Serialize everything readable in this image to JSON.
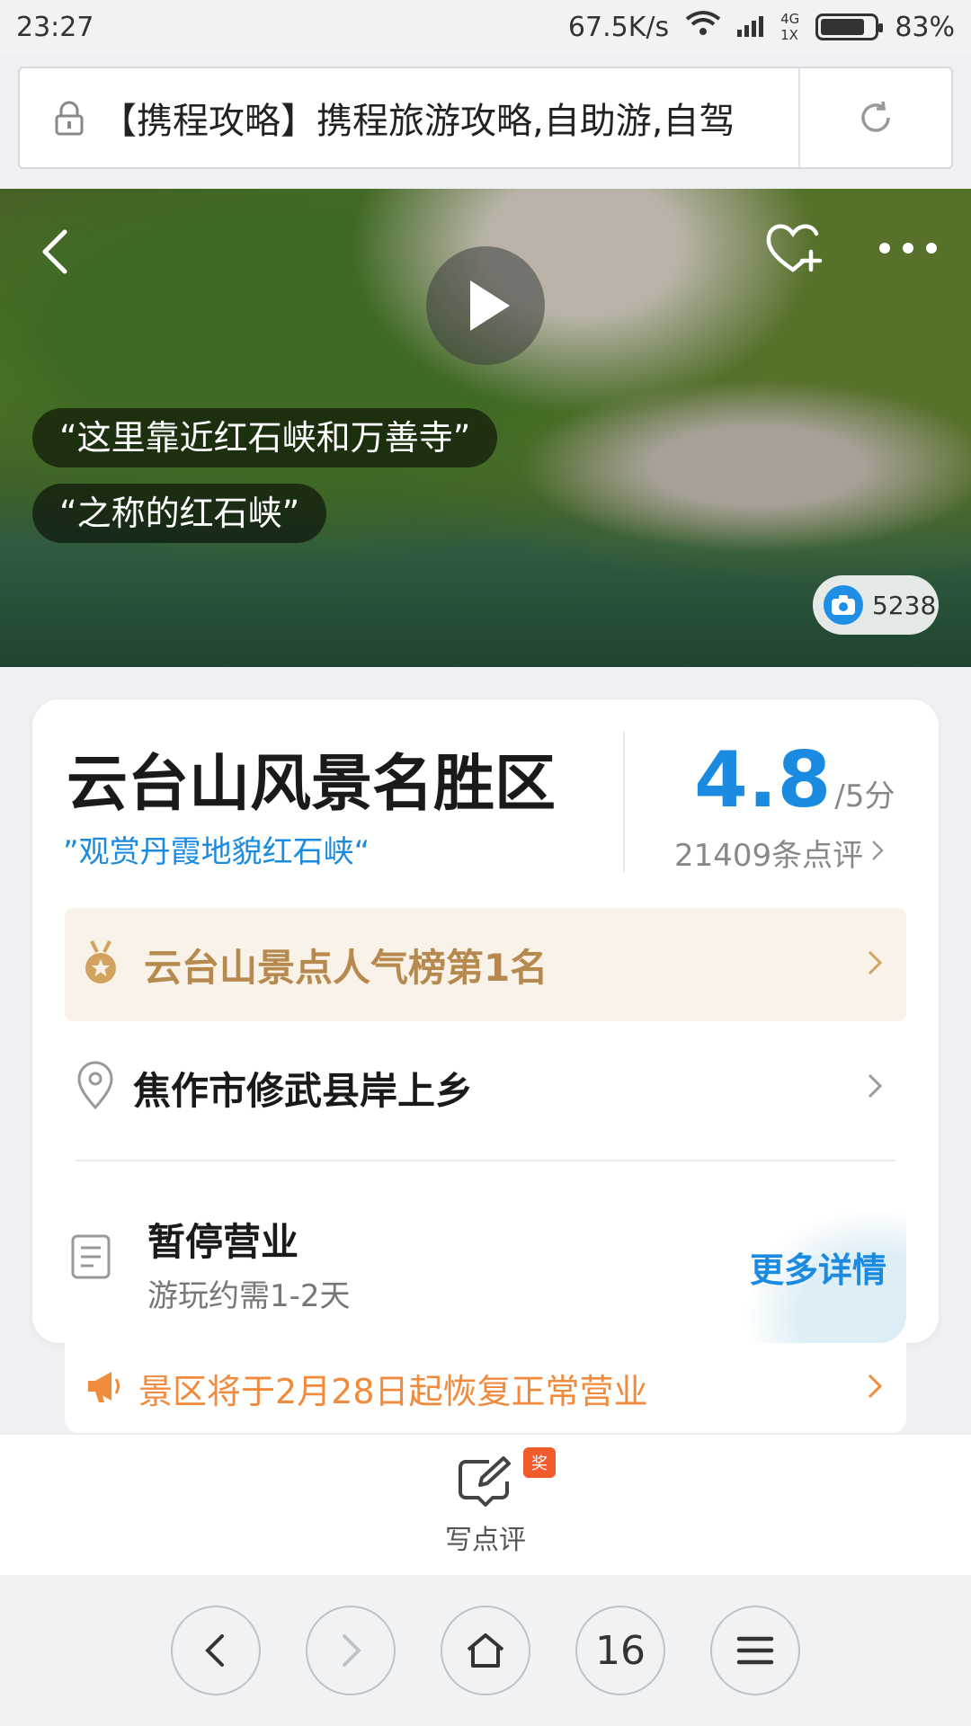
{
  "status_bar": {
    "time": "23:27",
    "network_speed": "67.5K/s",
    "network_type": "4G",
    "sim": "1X",
    "battery_percent": "83%",
    "battery_level": 0.83
  },
  "url_bar": {
    "title": "【携程攻略】携程旅游攻略,自助游,自驾"
  },
  "hero": {
    "quote_1": "“这里靠近红石峡和万善寺”",
    "quote_2": "“之称的红石峡”",
    "photo_count": "5238"
  },
  "attraction": {
    "name": "云台山风景名胜区",
    "tagline": "”观赏丹霞地貌红石峡“",
    "rating": "4.8",
    "rating_max": "/5分",
    "review_count": "21409条点评",
    "rank": "云台山景点人气榜第1名",
    "address": "焦作市修武县岸上乡",
    "status": "暂停营业",
    "duration": "游玩约需1-2天",
    "more_details": "更多详情"
  },
  "notice": {
    "text": "景区将于2月28日起恢复正常营业"
  },
  "write_review": {
    "label": "写点评",
    "badge": "奖"
  },
  "browser_nav": {
    "tab_count": "16"
  },
  "colors": {
    "accent_blue": "#1a8be0",
    "gold": "#b68a4e",
    "notice_orange": "#f28a3c",
    "badge_red": "#f05b2b"
  }
}
